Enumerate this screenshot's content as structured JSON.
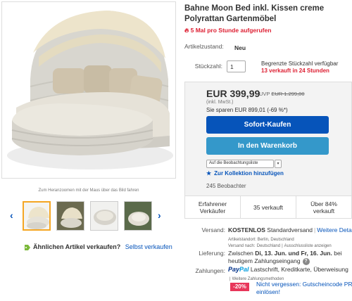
{
  "gallery": {
    "zoom_hint": "Zum Heranzoomen mit der Maus über das Bild fahren",
    "prev_icon": "chevron-left-icon",
    "next_icon": "chevron-right-icon",
    "thumb_count": 4
  },
  "sell_similar": {
    "question": "Ähnlichen Artikel verkaufen?",
    "link": "Selbst verkaufen"
  },
  "item": {
    "title": "Bahne Moon Bed inkl. Kissen creme Polyrattan Gartenmöbel",
    "hot_text": "5 Mal pro Stunde aufgerufen",
    "condition_label": "Artikelzustand:",
    "condition_value": "Neu",
    "quantity_label": "Stückzahl:",
    "quantity_value": "1",
    "stock_note": "Begrenzte Stückzahl verfügbar",
    "sold_recent": "13 verkauft in 24 Stunden"
  },
  "buybox": {
    "price": "EUR 399,99",
    "uvp_label": "UVP",
    "uvp_value": "EUR 1.299,00",
    "vat": "(inkl. MwSt.)",
    "savings": "Sie sparen EUR 899,01 (-69 %*)",
    "buy_now": "Sofort-Kaufen",
    "add_to_cart": "In den Warenkorb",
    "watch_select": "Auf die Beobachtungsliste",
    "collection_link": "Zur Kollektion hinzufügen",
    "watchers": "245 Beobachter"
  },
  "stats": [
    {
      "text": "Erfahrener Verkäufer"
    },
    {
      "text": "35 verkauft"
    },
    {
      "text": "Über 84% verkauft"
    }
  ],
  "shipping": {
    "label": "Versand:",
    "cost": "KOSTENLOS",
    "type": "Standardversand",
    "more_link": "Weitere Details",
    "location": "Artikelstandort: Berlin, Deutschland",
    "ships_to_label": "Versand nach:",
    "ships_to": "Deutschland",
    "exclusions_link": "Ausschlussliste anzeigen"
  },
  "delivery": {
    "label": "Lieferung:",
    "line1_prefix": "Zwischen",
    "line1_dates": "Di, 13. Jun. und Fr, 16. Jun.",
    "line1_suffix": "bei",
    "line2": "heutigem Zahlungseingang"
  },
  "payment": {
    "label": "Zahlungen:",
    "paypal_1": "Pay",
    "paypal_2": "Pal",
    "methods": "Lastschrift, Kreditkarte, Überweisung",
    "more_link": "Weitere Zahlungsmethoden"
  },
  "promo": {
    "badge": "-20%",
    "line1": "Nicht vergessen: Gutscheincode PREIS",
    "line2": "einlösen!"
  },
  "colors": {
    "buy_button": "#0654ba",
    "cart_button": "#3498ca",
    "hot_red": "#dd1e31",
    "discount_pink": "#e8365a"
  }
}
